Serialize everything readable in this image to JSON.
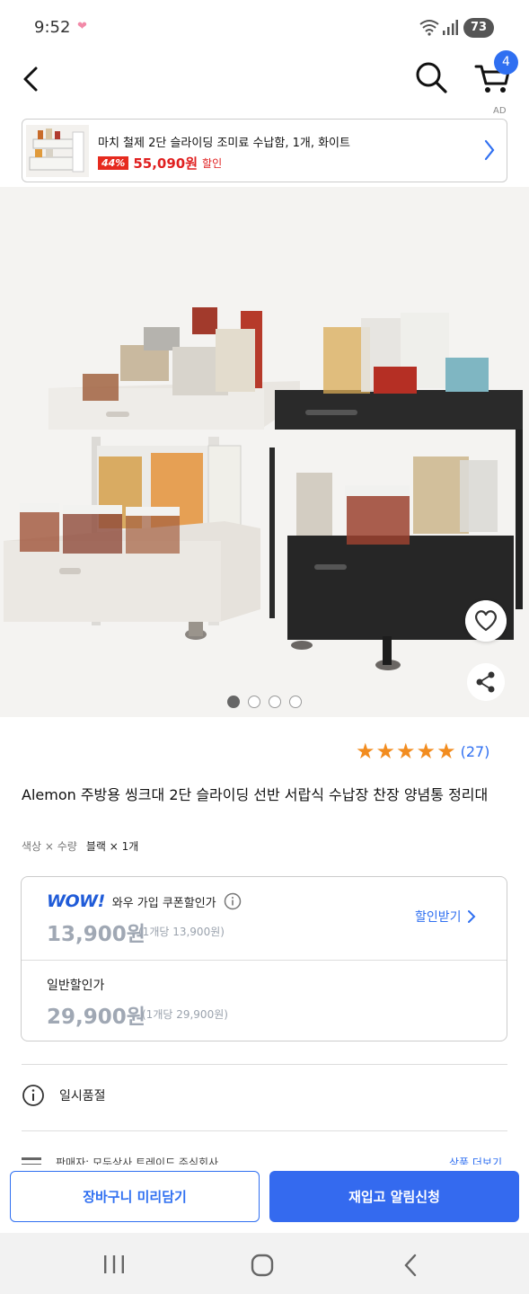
{
  "status_bar": {
    "time": "9:52",
    "battery": "73"
  },
  "header": {
    "cart_count": "4"
  },
  "ad": {
    "label": "AD",
    "title": "마치 철제 2단 슬라이딩 조미료 수납함, 1개, 화이트",
    "discount": "44%",
    "price": "55,090원",
    "sale_label": "할인"
  },
  "gallery": {
    "image_count": 4,
    "active_index": 0
  },
  "rating": {
    "stars": 5,
    "count": "(27)"
  },
  "product": {
    "title": "Alemon 주방용 씽크대 2단 슬라이딩 선반 서랍식 수납장 찬장 양념통 정리대",
    "option_label": "색상 × 수량",
    "option_value": "블랙 × 1개"
  },
  "pricing": {
    "wow_logo": "WOW!",
    "wow_label": "와우 가입 쿠폰할인가",
    "wow_price": "13,900원",
    "wow_unit": "(1개당 13,900원)",
    "coupon_button": "할인받기",
    "normal_label": "일반할인가",
    "normal_price": "29,900원",
    "normal_unit": "(1개당 29,900원)"
  },
  "stock": {
    "status": "일시품절"
  },
  "peek_row": {
    "text": "판매자: 모두상사 트레이드 주식회사",
    "link": "상품 더보기"
  },
  "actions": {
    "cart_preview": "장바구니 미리담기",
    "restock_alert": "재입고 알림신청"
  }
}
